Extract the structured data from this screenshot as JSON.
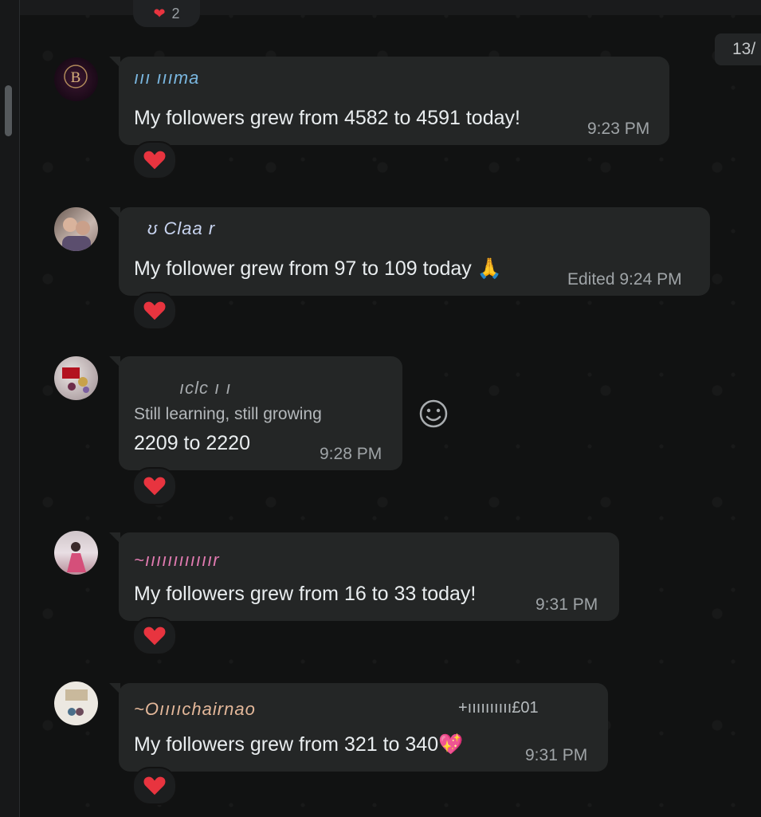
{
  "header": {
    "date_chip": "13/",
    "previous_reaction_count": "2"
  },
  "colors": {
    "bubble": "#242626",
    "heart": "#e8343f",
    "background": "#121212"
  },
  "messages": [
    {
      "sender": "ııı ıııma",
      "sender_color": "#7ab7e0",
      "text": "My followers grew from 4582 to 4591 today!",
      "time": "9:23 PM",
      "reaction": "heart"
    },
    {
      "sender": "ʊ Claa r",
      "sender_color": "#c8d4f0",
      "text": "My follower grew from 97 to 109 today 🙏",
      "time": "Edited 9:24 PM",
      "reaction": "heart"
    },
    {
      "sender": "ıclc ı ı",
      "sender_color": "#a6aaad",
      "subtitle": "Still learning, still growing",
      "text": "2209 to 2220",
      "time": "9:28 PM",
      "reaction": "heart"
    },
    {
      "sender": "~ıııııııııııır",
      "sender_color": "#e07ab0",
      "text": "My followers grew from 16 to 33 today!",
      "time": "9:31 PM",
      "reaction": "heart"
    },
    {
      "sender": "~Oııııchairnao",
      "sender_color": "#e4b89a",
      "sender_extra": "+ıııııııııı£01",
      "text": "My followers grew from 321 to 340💖",
      "time": "9:31 PM",
      "reaction": "heart"
    }
  ]
}
